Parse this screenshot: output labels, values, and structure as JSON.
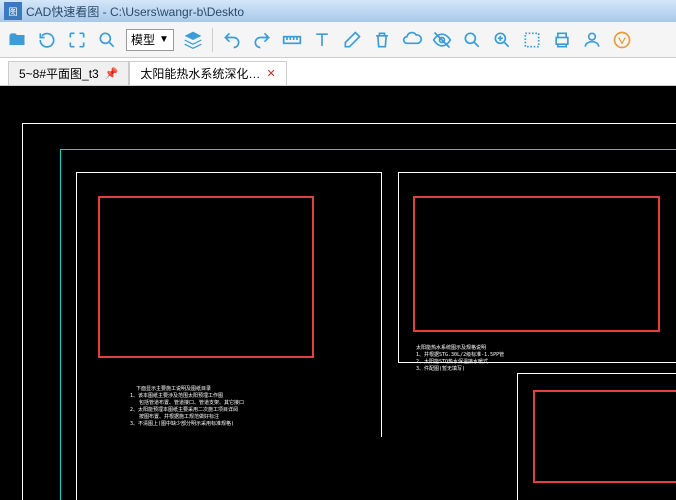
{
  "window": {
    "title": "CAD快速看图 - C:\\Users\\wangr-b\\Deskto"
  },
  "toolbar": {
    "dropdown_label": "模型"
  },
  "tabs": [
    {
      "label": "5~8#平面图_t3",
      "active": false
    },
    {
      "label": "太阳能热水系统深化…",
      "active": true
    }
  ],
  "canvas": {
    "text_block_1": "  下面显示主要施工说明及图纸目录\n1、该本图纸主要涉及范围太阳预埋工作图\n   包括管道布置、管道接口、管道支架、其它接口\n2、太阳能预埋本图纸主要采用二次施工项目详阅\n   按图布置、并根据施工规范做好标注\n3、不清图上(图中缺少部分明示采用标准规格)",
    "text_block_2": "太阳能热水系统图示及规格说明\n1、并根据STG.30L/2级标准-1.5PP管\n2、太阳能STQ热水保温接水暖式\n3、件配图(暂无填写)"
  }
}
